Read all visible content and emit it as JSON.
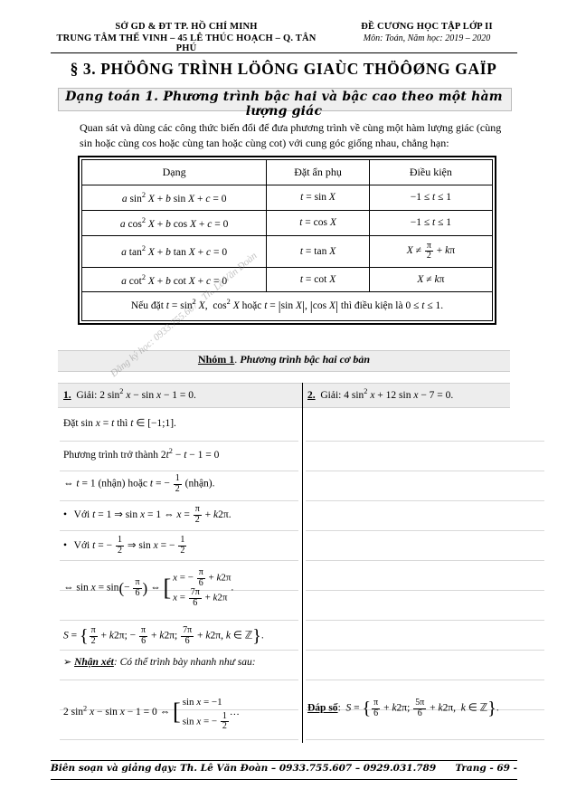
{
  "header": {
    "left_line1": "SỞ GD & ĐT TP. HỒ CHÍ MINH",
    "left_line2": "TRUNG TÂM THẾ VINH – 45 LÊ THÚC HOẠCH – Q. TÂN PHÚ",
    "right_line1": "ĐỀ CƯƠNG HỌC TẬP LỚP II",
    "right_line2": "Môn: Toán, Năm học: 2019 – 2020"
  },
  "title": "§ 3.  PHÖÔNG TRÌNH LÖÔNG GIAÙC THÖÔØNG GAÏP",
  "banner": "Dạng toán 1. Phương trình bậc hai và bậc cao theo một hàm lượng giác",
  "intro": "Quan sát và dùng các công thức biến đổi để đưa phương trình về cùng một hàm lượng giác (cùng sin hoặc cùng cos hoặc cùng tan hoặc cùng cot) với cung góc giống nhau, chẳng hạn:",
  "table": {
    "headers": [
      "Dạng",
      "Đặt ẩn phụ",
      "Điều kiện"
    ],
    "rows": [
      {
        "form": "a sin² X + b sin X + c = 0",
        "sub": "t = sin X",
        "cond": "−1 ≤ t ≤ 1"
      },
      {
        "form": "a cos² X + b cos X + c = 0",
        "sub": "t = cos X",
        "cond": "−1 ≤ t ≤ 1"
      },
      {
        "form": "a tan² X + b tan X + c = 0",
        "sub": "t = tan X",
        "cond": "X ≠ π/2 + kπ"
      },
      {
        "form": "a cot² X + b cot X + c = 0",
        "sub": "t = cot X",
        "cond": "X ≠ kπ"
      }
    ],
    "note": "Nếu đặt t = sin² X,  cos² X hoặc t = |sin X|, |cos X| thì điều kiện là 0 ≤ t ≤ 1."
  },
  "group": {
    "label": "Nhóm 1",
    "name": "Phương trình bậc hai cơ bản"
  },
  "exercise1": {
    "number": "1.",
    "prompt": "Giải: 2 sin² x − sin x − 1 = 0.",
    "steps": [
      "Đặt sin x = t thì t ∈ [−1;1].",
      "Phương trình trở thành 2t² − t − 1 = 0",
      "⇔ t = 1 (nhận) hoặc t = − 1/2 (nhận).",
      "• Với t = 1 ⇒ sin x = 1 ⇔ x = π/2 + k2π.",
      "• Với t = − 1/2 ⇒ sin x = − 1/2",
      "⇔ sin x = sin(− π/6) ⇔ [ x = − π/6 + k2π ; x = 7π/6 + k2π ].",
      "S = { π/2 + k2π; − π/6 + k2π; 7π/6 + k2π, k ∈ ℤ }.",
      "➢ Nhận xét: Có thể trình bày nhanh như sau:",
      "2 sin² x − sin x − 1 = 0 ⇔ [ sin x = −1 ; sin x = − 1/2 ] …"
    ],
    "remark_label": "Nhận xét",
    "remark_text": "Có thể trình bày nhanh như sau:"
  },
  "exercise2": {
    "number": "2.",
    "prompt": "Giải: 4 sin² x + 12 sin x − 7 = 0.",
    "answer_label": "Đáp số",
    "answer": "S = { π/6 + k2π;  5π/6 + k2π,  k ∈ ℤ }."
  },
  "watermark": "Đăng ký học: 0933.755.607 - Th. Lê Văn Đoàn",
  "footer": {
    "left": "Biên soạn và giảng dạy: Th. Lê Văn Đoàn – 0933.755.607 – 0929.031.789",
    "right": "Trang - 69 -"
  }
}
